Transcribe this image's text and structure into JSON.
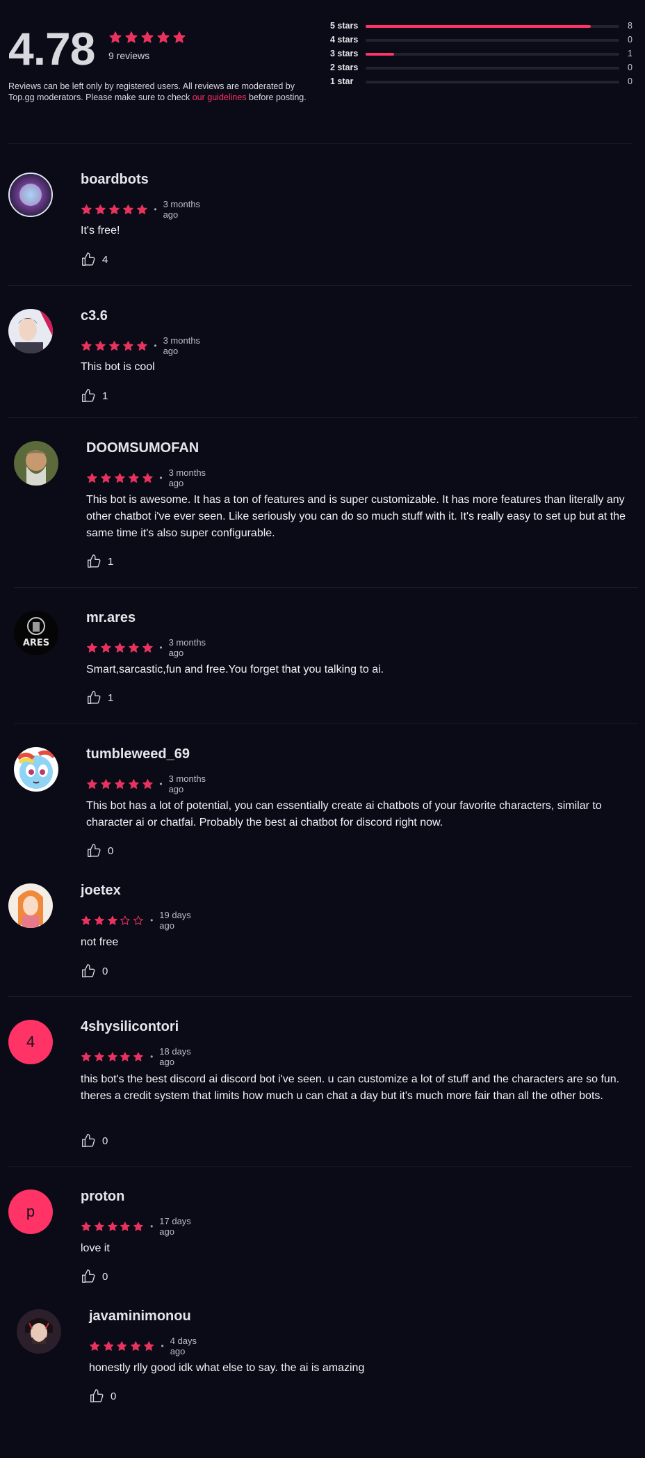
{
  "summary": {
    "rating": "4.78",
    "review_count": "9 reviews",
    "note_before": "Reviews can be left only by registered users. All reviews are moderated by Top.gg moderators. Please make sure to check ",
    "note_link": "our guidelines",
    "note_after": " before posting."
  },
  "breakdown": [
    {
      "label": "5 stars",
      "count": "8",
      "fraction": 0.889
    },
    {
      "label": "4 stars",
      "count": "0",
      "fraction": 0
    },
    {
      "label": "3 stars",
      "count": "1",
      "fraction": 0.111
    },
    {
      "label": "2 stars",
      "count": "0",
      "fraction": 0
    },
    {
      "label": "1 star",
      "count": "0",
      "fraction": 0
    }
  ],
  "reviews": [
    {
      "username": "boardbots",
      "stars": 5,
      "dot": "•",
      "time": "3 months ago",
      "text": "It's free!",
      "likes": "4"
    },
    {
      "username": "c3.6",
      "stars": 5,
      "dot": "•",
      "time": "3 months ago",
      "text": "This bot is cool",
      "likes": "1"
    },
    {
      "username": "DOOMSUMOFAN",
      "stars": 5,
      "dot": "•",
      "time": "3 months ago",
      "text": "This bot is awesome. It has a ton of features and is super customizable. It has more features than literally any other chatbot i've ever seen. Like seriously you can do so much stuff with it. It's really easy to set up but at the same time it's also super configurable.",
      "likes": "1"
    },
    {
      "username": "mr.ares",
      "stars": 5,
      "dot": "•",
      "time": "3 months ago",
      "text": "Smart,sarcastic,fun and free.You forget that you talking to ai.",
      "likes": "1",
      "avatar_text": "ARES"
    },
    {
      "username": "tumbleweed_69",
      "stars": 5,
      "dot": "•",
      "time": "3 months ago",
      "text": "This bot has a lot of potential, you can essentially create ai chatbots of your favorite characters, similar to character ai or chatfai. Probably the best ai chatbot for discord right now.",
      "likes": "0"
    },
    {
      "username": "joetex",
      "stars": 3,
      "dot": "•",
      "time": "19 days ago",
      "text": "not free",
      "likes": "0"
    },
    {
      "username": "4shysilicontori",
      "stars": 5,
      "dot": "•",
      "time": "18 days ago",
      "text": "this bot's the best discord ai discord bot i've seen. u can customize a lot of stuff and the characters are so fun. theres a credit system that limits how much u can chat a day but it's much more fair than all the other bots.",
      "likes": "0",
      "avatar_letter": "4"
    },
    {
      "username": "proton",
      "stars": 5,
      "dot": "•",
      "time": "17 days ago",
      "text": "love it",
      "likes": "0",
      "avatar_letter": "p"
    },
    {
      "username": "javaminimonou",
      "stars": 5,
      "dot": "•",
      "time": "4 days ago",
      "text": "honestly rlly good idk what else to say. the ai is amazing",
      "likes": "0"
    }
  ],
  "colors": {
    "accent": "#ff3366",
    "star": "#e8335f",
    "background": "#0b0a17"
  },
  "icons": {
    "star": "star-icon",
    "like": "thumbs-up-icon"
  }
}
